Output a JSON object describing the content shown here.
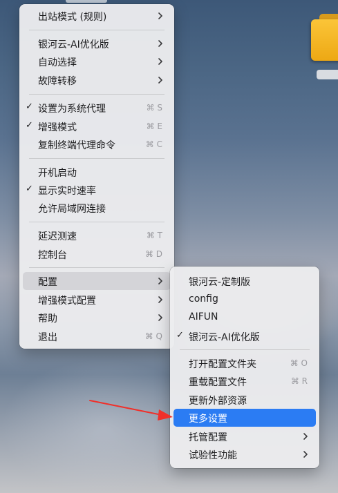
{
  "main_menu": {
    "items": [
      {
        "label": "出站模式 (规则)",
        "checked": false,
        "shortcut": "",
        "submenu": true
      },
      {
        "label": "银河云-AI优化版",
        "checked": false,
        "shortcut": "",
        "submenu": true
      },
      {
        "label": "自动选择",
        "checked": false,
        "shortcut": "",
        "submenu": true
      },
      {
        "label": "故障转移",
        "checked": false,
        "shortcut": "",
        "submenu": true
      },
      {
        "label": "设置为系统代理",
        "checked": true,
        "shortcut": "⌘ S",
        "submenu": false
      },
      {
        "label": "增强模式",
        "checked": true,
        "shortcut": "⌘ E",
        "submenu": false
      },
      {
        "label": "复制终端代理命令",
        "checked": false,
        "shortcut": "⌘ C",
        "submenu": false
      },
      {
        "label": "开机启动",
        "checked": false,
        "shortcut": "",
        "submenu": false
      },
      {
        "label": "显示实时速率",
        "checked": true,
        "shortcut": "",
        "submenu": false
      },
      {
        "label": "允许局域网连接",
        "checked": false,
        "shortcut": "",
        "submenu": false
      },
      {
        "label": "延迟测速",
        "checked": false,
        "shortcut": "⌘ T",
        "submenu": false
      },
      {
        "label": "控制台",
        "checked": false,
        "shortcut": "⌘ D",
        "submenu": false
      },
      {
        "label": "配置",
        "checked": false,
        "shortcut": "",
        "submenu": true,
        "state": "hover"
      },
      {
        "label": "增强模式配置",
        "checked": false,
        "shortcut": "",
        "submenu": true
      },
      {
        "label": "帮助",
        "checked": false,
        "shortcut": "",
        "submenu": true
      },
      {
        "label": "退出",
        "checked": false,
        "shortcut": "⌘ Q",
        "submenu": false
      }
    ]
  },
  "config_submenu": {
    "items": [
      {
        "label": "银河云-定制版",
        "checked": false,
        "shortcut": "",
        "submenu": false
      },
      {
        "label": "config",
        "checked": false,
        "shortcut": "",
        "submenu": false
      },
      {
        "label": "AIFUN",
        "checked": false,
        "shortcut": "",
        "submenu": false
      },
      {
        "label": "银河云-AI优化版",
        "checked": true,
        "shortcut": "",
        "submenu": false
      },
      {
        "label": "打开配置文件夹",
        "checked": false,
        "shortcut": "⌘ O",
        "submenu": false
      },
      {
        "label": "重载配置文件",
        "checked": false,
        "shortcut": "⌘ R",
        "submenu": false
      },
      {
        "label": "更新外部资源",
        "checked": false,
        "shortcut": "",
        "submenu": false
      },
      {
        "label": "更多设置",
        "checked": false,
        "shortcut": "",
        "submenu": false,
        "state": "active"
      },
      {
        "label": "托管配置",
        "checked": false,
        "shortcut": "",
        "submenu": true
      },
      {
        "label": "试验性功能",
        "checked": false,
        "shortcut": "",
        "submenu": true
      }
    ]
  },
  "colors": {
    "highlight": "#2b7cf3",
    "hover": "#d4d4d8",
    "annotation_arrow": "#f0302a"
  },
  "icons": {
    "check": "✓",
    "submenu": "chevron-right-icon",
    "annotation": "red-arrow-icon",
    "desktop": "folder-icon"
  }
}
